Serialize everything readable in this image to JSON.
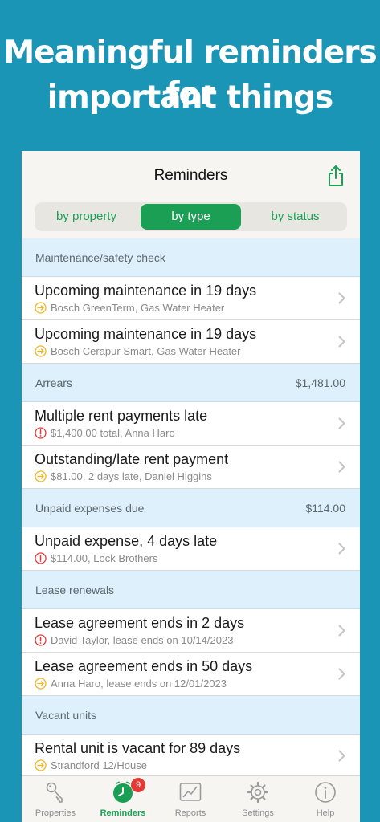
{
  "hero": {
    "line1": "Meaningful reminders for",
    "line2": "important things"
  },
  "nav": {
    "title": "Reminders",
    "share_icon": "share-icon"
  },
  "segments": [
    {
      "label": "by property",
      "active": false
    },
    {
      "label": "by type",
      "active": true
    },
    {
      "label": "by status",
      "active": false
    }
  ],
  "sections": [
    {
      "title": "Maintenance/safety check",
      "amount": ""
    },
    {
      "title": "Arrears",
      "amount": "$1,481.00"
    },
    {
      "title": "Unpaid expenses due",
      "amount": "$114.00"
    },
    {
      "title": "Lease renewals",
      "amount": ""
    },
    {
      "title": "Vacant units",
      "amount": ""
    }
  ],
  "rows": [
    {
      "title": "Upcoming maintenance in 19 days",
      "subtitle": "Bosch GreenTerm, Gas Water Heater",
      "status": "upcoming"
    },
    {
      "title": "Upcoming maintenance in 19 days",
      "subtitle": "Bosch Cerapur Smart, Gas Water Heater",
      "status": "upcoming"
    },
    {
      "title": "Multiple rent payments late",
      "subtitle": "$1,400.00 total, Anna Haro",
      "status": "overdue"
    },
    {
      "title": "Outstanding/late rent payment",
      "subtitle": "$81.00, 2 days late, Daniel Higgins",
      "status": "upcoming"
    },
    {
      "title": "Unpaid expense, 4 days late",
      "subtitle": "$114.00, Lock Brothers",
      "status": "overdue"
    },
    {
      "title": "Lease agreement ends in 2 days",
      "subtitle": "David Taylor, lease ends on 10/14/2023",
      "status": "overdue"
    },
    {
      "title": "Lease agreement ends in 50 days",
      "subtitle": "Anna Haro, lease ends on 12/01/2023",
      "status": "upcoming"
    },
    {
      "title": "Rental unit is vacant for 89 days",
      "subtitle": "Strandford 12/House",
      "status": "upcoming"
    }
  ],
  "tabs": [
    {
      "label": "Properties",
      "icon": "key-icon",
      "active": false
    },
    {
      "label": "Reminders",
      "icon": "clock-icon",
      "active": true,
      "badge": "9"
    },
    {
      "label": "Reports",
      "icon": "chart-icon",
      "active": false
    },
    {
      "label": "Settings",
      "icon": "gear-icon",
      "active": false
    },
    {
      "label": "Help",
      "icon": "info-icon",
      "active": false
    }
  ],
  "colors": {
    "background": "#1a95b6",
    "accent": "#1a9f55",
    "section": "#def0fb",
    "warning": "#f2b51c",
    "danger": "#e53935"
  }
}
